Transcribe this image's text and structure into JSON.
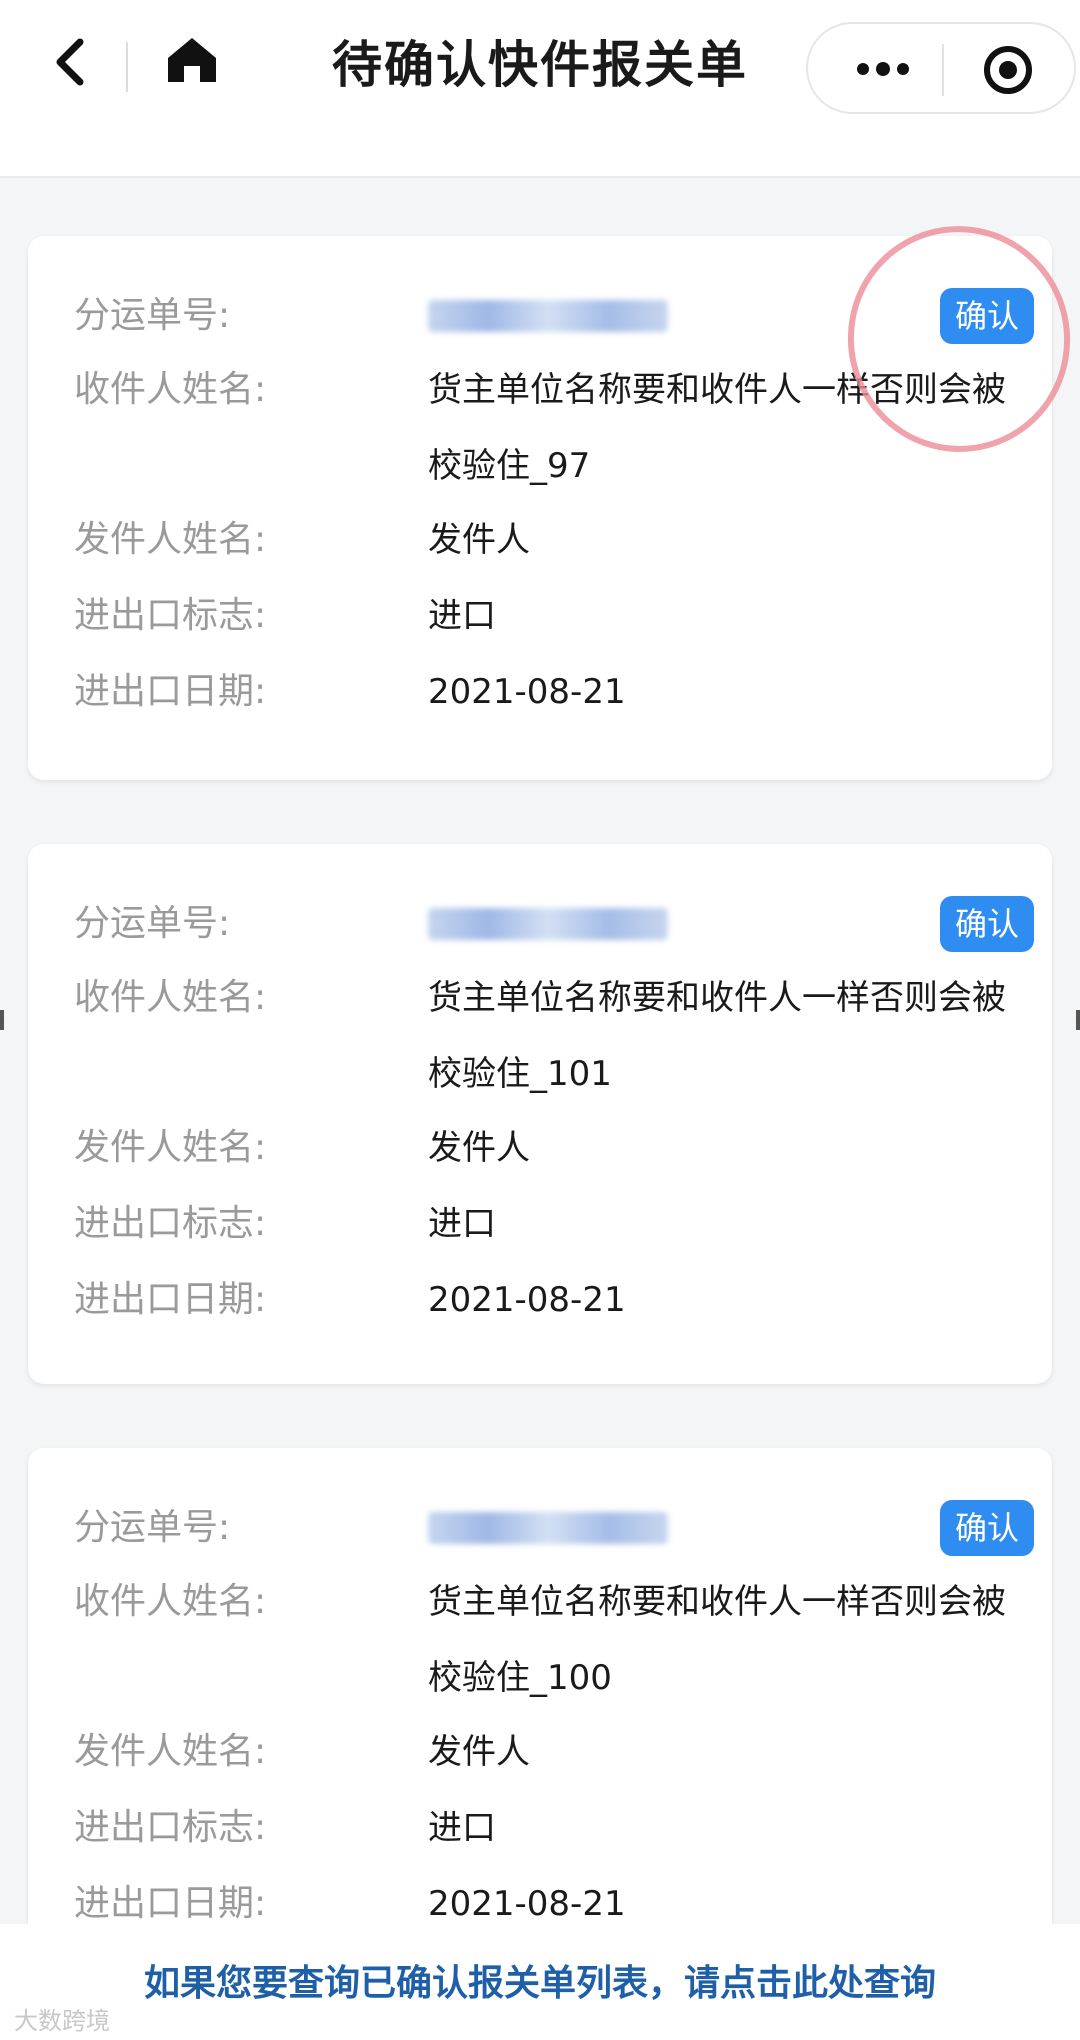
{
  "navbar": {
    "title": "待确认快件报关单",
    "back_icon": "chevron-left-icon",
    "home_icon": "home-icon",
    "more_icon": "more-dots-icon",
    "target_icon": "target-icon"
  },
  "labels": {
    "waybill": "分运单号:",
    "recipient": "收件人姓名:",
    "sender": "发件人姓名:",
    "io_flag": "进出口标志:",
    "io_date": "进出口日期:"
  },
  "confirm_label": "确认",
  "cards": [
    {
      "waybill": "",
      "recipient": "货主单位名称要和收件人一样否则会被校验住_97",
      "sender": "发件人",
      "io_flag": "进口",
      "io_date": "2021-08-21"
    },
    {
      "waybill": "",
      "recipient": "货主单位名称要和收件人一样否则会被校验住_101",
      "sender": "发件人",
      "io_flag": "进口",
      "io_date": "2021-08-21"
    },
    {
      "waybill": "",
      "recipient": "货主单位名称要和收件人一样否则会被校验住_100",
      "sender": "发件人",
      "io_flag": "进口",
      "io_date": "2021-08-21"
    }
  ],
  "footer": {
    "link": "如果您要查询已确认报关单列表，请点击此处查询",
    "watermark": "大数跨境"
  },
  "colors": {
    "accent": "#2f8df2",
    "link": "#1f5fa8",
    "label": "#9a9a9a",
    "annotation": "#ec8c96"
  }
}
